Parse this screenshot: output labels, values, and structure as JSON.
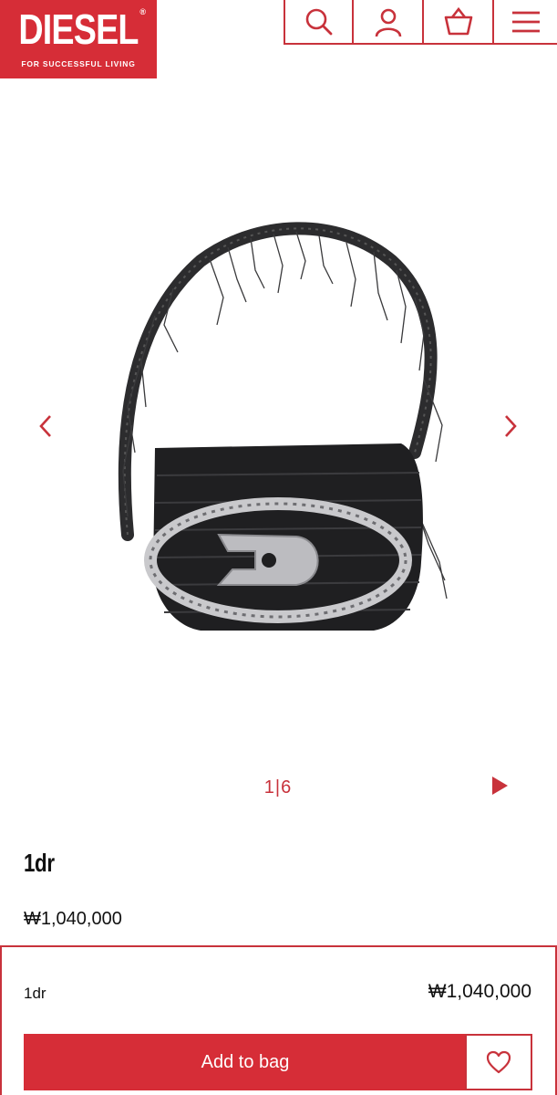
{
  "header": {
    "logo_text": "DIESEL",
    "logo_registered": "®",
    "logo_tagline": "FOR SUCCESSFUL LIVING",
    "icons": [
      "search-icon",
      "account-icon",
      "basket-icon",
      "menu-icon"
    ]
  },
  "gallery": {
    "current": "1",
    "separator": "|",
    "total": "6"
  },
  "product": {
    "name": "1dr",
    "price": "₩1,040,000"
  },
  "buy_panel": {
    "name": "1dr",
    "price": "₩1,040,000",
    "add_to_bag_label": "Add to bag"
  },
  "colors": {
    "brand_red": "#d62d37",
    "border_red": "#c8323b"
  }
}
